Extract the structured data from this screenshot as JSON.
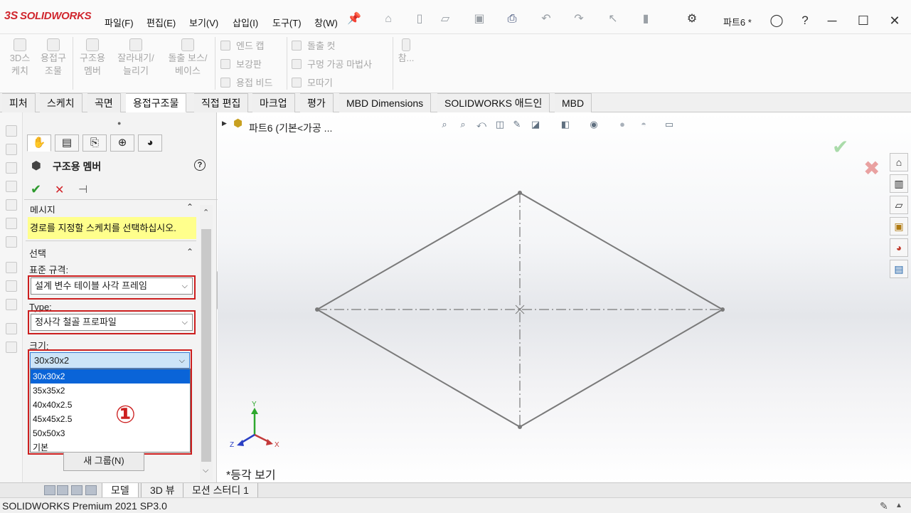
{
  "titlebar": {
    "logo_ds": "3S",
    "logo_text": "SOLIDWORKS",
    "menus": [
      "파일(F)",
      "편집(E)",
      "보기(V)",
      "삽입(I)",
      "도구(T)",
      "창(W)"
    ],
    "document_name": "파트6 *"
  },
  "command_manager": {
    "big_buttons": [
      {
        "label1": "3D스",
        "label2": "케치"
      },
      {
        "label1": "용접구",
        "label2": "조물"
      },
      {
        "label1": "구조용",
        "label2": "멤버"
      },
      {
        "label1": "잘라내기/",
        "label2": "늘리기"
      },
      {
        "label1": "돌출 보스/",
        "label2": "베이스"
      }
    ],
    "small_col1": [
      "엔드 캡",
      "보강판",
      "용접 비드"
    ],
    "small_col2": [
      "돌출 컷",
      "구멍 가공 마법사",
      "모따기"
    ],
    "ref_label": "참..."
  },
  "tabs": [
    "피처",
    "스케치",
    "곡면",
    "용접구조물",
    "직접 편집",
    "마크업",
    "평가",
    "MBD Dimensions",
    "SOLIDWORKS 애드인",
    "MBD"
  ],
  "active_tab_index": 3,
  "property_manager": {
    "title": "구조용 멤버",
    "help_icon": "?",
    "ok_icon": "✔",
    "cancel_icon": "✕",
    "pin_icon": "⊣",
    "message_header": "메시지",
    "message": "경로를 지정할 스케치를 선택하십시오.",
    "selection_header": "선택",
    "standard_label": "표준 규격:",
    "standard_value": "설계 변수 테이블 사각 프레임",
    "type_label": "Type:",
    "type_value": "정사각 철골 프로파일",
    "size_label": "크기:",
    "size_value": "30x30x2",
    "size_options": [
      "30x30x2",
      "35x35x2",
      "40x40x2.5",
      "45x45x2.5",
      "50x50x3",
      "기본"
    ],
    "selected_option_index": 0,
    "annotation_number": "①",
    "new_group_button": "새 그룹(N)"
  },
  "viewport": {
    "tree_label": "파트6  (기본<가공 ...",
    "view_label": "*등각 보기",
    "axis_labels": {
      "x": "X",
      "y": "Y",
      "z": "Z"
    }
  },
  "bottom_tabs": [
    "모델",
    "3D 뷰",
    "모션 스터디 1"
  ],
  "active_bottom_tab": 0,
  "status": {
    "text": "SOLIDWORKS Premium 2021 SP3.0"
  },
  "colors": {
    "brand_red": "#d0262e",
    "highlight_red": "#cc1f1f",
    "message_yellow": "#ffff8c",
    "selection_blue": "#0a64d8",
    "sketch_gray": "#7a7a7a"
  }
}
